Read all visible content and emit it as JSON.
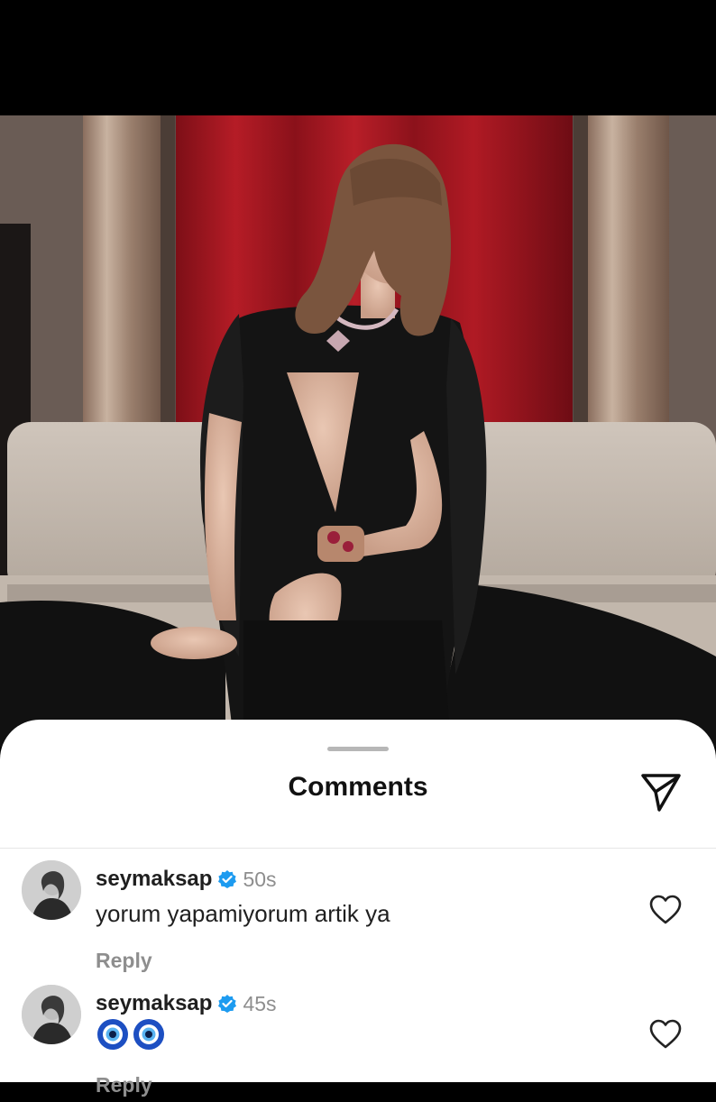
{
  "sheet": {
    "title": "Comments",
    "share_icon": "send-icon"
  },
  "comments": [
    {
      "username": "seymaksap",
      "verified": true,
      "time": "50s",
      "text": "yorum yapamiyorum artik ya",
      "reply_label": "Reply"
    },
    {
      "username": "seymaksap",
      "verified": true,
      "time": "45s",
      "text": "🧿🧿",
      "reply_label": "Reply"
    }
  ],
  "colors": {
    "verified": "#1D9BF0",
    "muted": "#8E8E8E",
    "curtain": "#9E1620"
  }
}
